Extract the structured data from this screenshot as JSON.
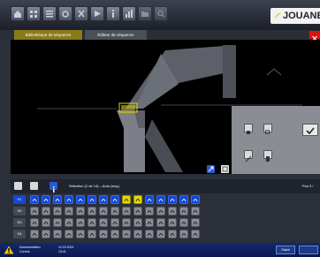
{
  "app": {
    "logo_text": "JOUANE",
    "colors": {
      "accent": "#8a7a1a",
      "highlight": "#e8d800",
      "cell_blue": "#1446d8",
      "status_bar": "#12296e",
      "close": "#dd1111"
    }
  },
  "toolbar": {
    "buttons": [
      "home-icon",
      "grid-icon",
      "list-icon",
      "settings-icon",
      "tools-icon",
      "play-icon",
      "info-icon",
      "chart-icon",
      "folder-icon",
      "search-icon"
    ]
  },
  "tabs": [
    {
      "label": "Bibliothèque de séquence",
      "active": true
    },
    {
      "label": "Éditeur de séquence",
      "active": false
    }
  ],
  "canvas": {
    "info_line": ""
  },
  "sequence_bar": {
    "selection": "Sélection (1 de 14)  –  Auto (seq.)",
    "position": "Pos 3 /"
  },
  "grid": {
    "rows": [
      {
        "label": "S1",
        "style": "blue"
      },
      {
        "label": "S2",
        "style": "gray"
      },
      {
        "label": "S3",
        "style": "gray"
      },
      {
        "label": "S4",
        "style": "gray"
      }
    ],
    "columns": 15,
    "highlighted": [
      [
        0,
        8
      ],
      [
        0,
        9
      ]
    ]
  },
  "status": {
    "line1": "Documentation",
    "line2": "Correct",
    "date": "12.10.2021",
    "time": "13:41",
    "button": "Statut"
  }
}
